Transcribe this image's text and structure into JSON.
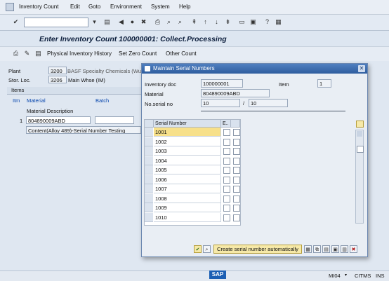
{
  "menu": [
    "Inventory Count",
    "Edit",
    "Goto",
    "Environment",
    "System",
    "Help"
  ],
  "page_title": "Enter Inventory Count 100000001: Collect.Processing",
  "app_toolbar": {
    "history": "Physical Inventory History",
    "zero": "Set Zero Count",
    "other": "Other Count"
  },
  "header": {
    "plant_label": "Plant",
    "plant_value": "3200",
    "plant_desc": "BASF Specialty Chemicals (Wuxi",
    "storloc_label": "Stor. Loc.",
    "storloc_value": "3206",
    "storloc_desc": "Main Whse (IM)"
  },
  "items": {
    "tab": "Items",
    "col_item": "Itm",
    "col_material": "Material",
    "col_batch": "Batch",
    "desc_label": "Material Description",
    "row_item": "1",
    "row_material": "804890009ABD",
    "row_desc": "Content(Alloy 489)-Serial Number Testing"
  },
  "dialog": {
    "title": "Maintain Serial Numbers",
    "invdoc_label": "Inventory doc",
    "invdoc_value": "100000001",
    "item_label": "Item",
    "item_value": "1",
    "material_label": "Material",
    "material_value": "804890009ABD",
    "noserial_label": "No.serial no",
    "noserial_value": "10",
    "slash": "/",
    "noserial_total": "10",
    "col_serial": "Serial Number",
    "col_e": "E..",
    "serials": [
      "1001",
      "1002",
      "1003",
      "1004",
      "1005",
      "1006",
      "1007",
      "1008",
      "1009",
      "1010"
    ],
    "create_btn": "Create serial number automatically"
  },
  "status": {
    "tx": "MI04",
    "server": "CITMS",
    "mode": "INS"
  },
  "sap_logo": "SAP"
}
